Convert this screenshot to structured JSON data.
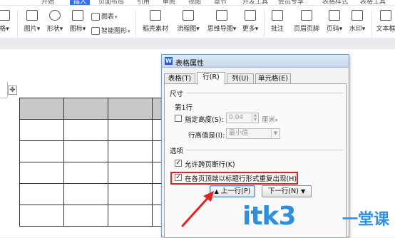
{
  "ribbon": {
    "top_tabs": [
      "开始",
      "插入",
      "页面布局",
      "引用",
      "审阅",
      "视图",
      "章节",
      "开发工具",
      "会员专享",
      "表格样式",
      "表格工具"
    ],
    "active_top_tab": "插入",
    "items_small": [
      {
        "label": "图表",
        "icon": "chart-icon"
      },
      {
        "label": "智能图形",
        "icon": "smartart-icon"
      }
    ],
    "items_big": [
      {
        "label": "格",
        "icon": "table-icon"
      },
      {
        "label": "图片",
        "icon": "picture-icon"
      },
      {
        "label": "形状",
        "icon": "shapes-icon"
      },
      {
        "label": "图标",
        "icon": "icons-icon"
      },
      {
        "label": "稻壳素材",
        "icon": "material-icon"
      },
      {
        "label": "流程图",
        "icon": "flowchart-icon"
      },
      {
        "label": "思维导图",
        "icon": "mindmap-icon"
      },
      {
        "label": "更多",
        "icon": "more-icon"
      },
      {
        "label": "批注",
        "icon": "comment-icon"
      },
      {
        "label": "页眉页脚",
        "icon": "header-footer-icon"
      },
      {
        "label": "页码",
        "icon": "page-number-icon"
      },
      {
        "label": "水印",
        "icon": "watermark-icon"
      },
      {
        "label": "文本框",
        "icon": "textbox-icon"
      }
    ]
  },
  "dialog": {
    "title": "表格属性",
    "tabs": [
      "表格(T)",
      "行(R)",
      "列(U)",
      "单元格(E)"
    ],
    "active_tab": "行(R)",
    "size_section": "尺寸",
    "row_label": "第1行",
    "specify_height_label": "指定高度(S):",
    "height_value": "0.04",
    "height_unit": "厘米",
    "row_height_is_label": "行高值是(I):",
    "row_height_mode": "最小值",
    "options_section": "选项",
    "allow_break_label": "允许跨页断行(K)",
    "repeat_header_label": "在各页顶端以标题行形式重复出现(H)",
    "prev_row_button": "上一行(P)",
    "next_row_button": "下一行(N)"
  },
  "watermark": {
    "text": "itk3",
    "suffix": "一堂课"
  },
  "colors": {
    "accent": "#3470e6",
    "highlight": "#e52222",
    "watermark": "#2d8fe0"
  }
}
